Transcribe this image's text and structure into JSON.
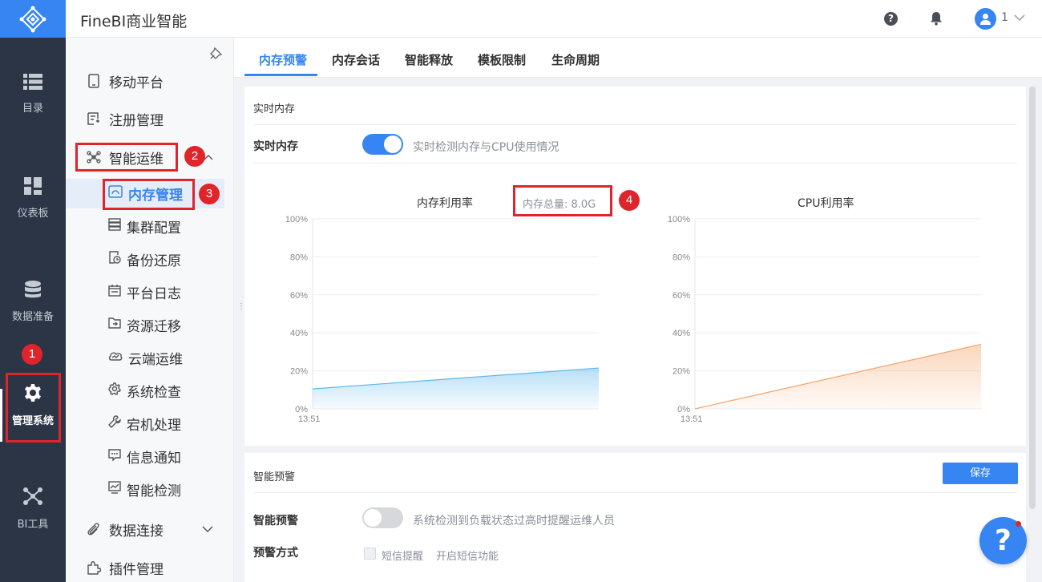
{
  "app": {
    "title": "FineBI商业智能",
    "user_name": "1"
  },
  "nav": {
    "items": [
      {
        "label": "目录",
        "icon": "list-icon"
      },
      {
        "label": "仪表板",
        "icon": "dashboard-icon"
      },
      {
        "label": "数据准备",
        "icon": "database-icon"
      },
      {
        "label": "管理系统",
        "icon": "gear-icon",
        "active": true
      },
      {
        "label": "BI工具",
        "icon": "network-icon"
      }
    ]
  },
  "sidebar": {
    "items": [
      {
        "label": "移动平台",
        "icon": "tablet-icon"
      },
      {
        "label": "注册管理",
        "icon": "register-icon"
      },
      {
        "label": "智能运维",
        "icon": "ops-icon",
        "expanded": true
      }
    ],
    "sub_items": [
      {
        "label": "内存管理",
        "icon": "memory-icon",
        "active": true
      },
      {
        "label": "集群配置",
        "icon": "cluster-icon"
      },
      {
        "label": "备份还原",
        "icon": "backup-icon"
      },
      {
        "label": "平台日志",
        "icon": "log-icon"
      },
      {
        "label": "资源迁移",
        "icon": "migrate-icon"
      },
      {
        "label": "云端运维",
        "icon": "cloud-ops-icon"
      },
      {
        "label": "系统检查",
        "icon": "check-icon"
      },
      {
        "label": "宕机处理",
        "icon": "wrench-icon"
      },
      {
        "label": "信息通知",
        "icon": "message-icon"
      },
      {
        "label": "智能检测",
        "icon": "monitor-icon"
      }
    ],
    "bottom_items": [
      {
        "label": "数据连接",
        "icon": "link-icon"
      },
      {
        "label": "插件管理",
        "icon": "plugin-icon"
      }
    ]
  },
  "tabs": [
    {
      "label": "内存预警",
      "active": true
    },
    {
      "label": "内存会话"
    },
    {
      "label": "智能释放"
    },
    {
      "label": "模板限制"
    },
    {
      "label": "生命周期"
    }
  ],
  "realtime": {
    "section_title": "实时内存",
    "row_label": "实时内存",
    "row_desc": "实时检测内存与CPU使用情况",
    "toggle_on": true
  },
  "charts_text": {
    "mem_title": "内存利用率",
    "mem_total": "内存总量: 8.0G",
    "cpu_title": "CPU利用率"
  },
  "chart_data": [
    {
      "type": "area",
      "title": "内存利用率",
      "x": [
        "13:51"
      ],
      "y_ticks": [
        "100%",
        "80%",
        "60%",
        "40%",
        "20%",
        "0%"
      ],
      "ylim": [
        0,
        100
      ],
      "series": [
        {
          "values_start_end": [
            10.5,
            21.5
          ]
        }
      ],
      "color": "#5fb8ec"
    },
    {
      "type": "area",
      "title": "CPU利用率",
      "x": [
        "13:51"
      ],
      "y_ticks": [
        "100%",
        "80%",
        "60%",
        "40%",
        "20%",
        "0%"
      ],
      "ylim": [
        0,
        100
      ],
      "series": [
        {
          "values_start_end": [
            0,
            34
          ]
        }
      ],
      "color": "#f5a56a"
    }
  ],
  "alert": {
    "section_title": "智能预警",
    "save_label": "保存",
    "row_label": "智能预警",
    "row_desc": "系统检测到负载状态过高时提醒运维人员",
    "toggle_on": false,
    "method_label": "预警方式",
    "sms_label": "短信提醒",
    "sms_desc": "开启短信功能"
  },
  "annotations": [
    "1",
    "2",
    "3",
    "4"
  ],
  "help_label": "?"
}
